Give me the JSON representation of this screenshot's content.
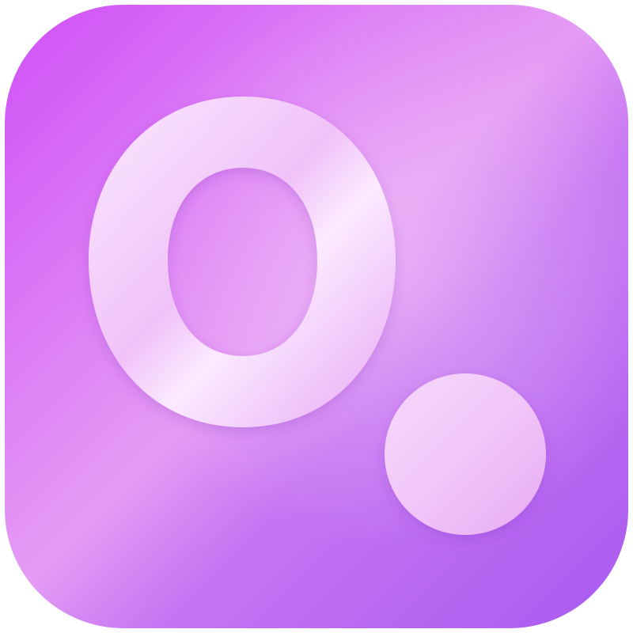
{
  "app_icon": {
    "glyph": "O.",
    "icon_name": "app-logo-icon",
    "colors": {
      "background_top_left": "#cf4ff7",
      "background_center": "#e59cf4",
      "background_bottom_right": "#a95af0",
      "letter_fill_light": "#fbeaff",
      "letter_fill_mid": "#f0c2f8",
      "dot_fill": "#f6d9fb"
    }
  }
}
